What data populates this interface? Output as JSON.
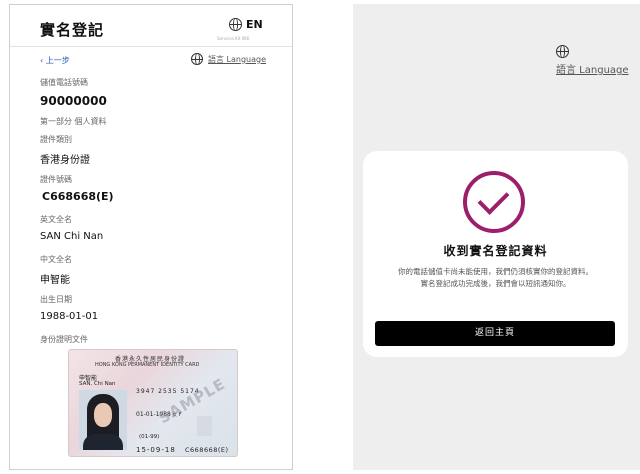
{
  "left": {
    "header": {
      "title": "實名登記",
      "lang_toggle": "EN",
      "sub_text": "Services Kit 0KK"
    },
    "back_label": "上一步",
    "language_link": "語言 Language",
    "fields": {
      "phone_label": "儲值電話號碼",
      "phone_value": "90000000",
      "section_label": "第一部分 個人資料",
      "doc_type_label": "證件類別",
      "doc_type_value": "香港身份證",
      "doc_no_label": "證件號碼",
      "doc_no_value": "C668668(E)",
      "en_name_label": "英文全名",
      "en_name_value": "SAN Chi Nan",
      "cn_name_label": "中文全名",
      "cn_name_value": "申智能",
      "dob_label": "出生日期",
      "dob_value": "1988-01-01",
      "doc_proof_label": "身份證明文件"
    },
    "id_card": {
      "title_cn": "香港永久性居民身份證",
      "title_en": "HONG KONG PERMANENT IDENTITY CARD",
      "name_cn": "申智能",
      "name_en": "SAN, Chi Nan",
      "digits": "3947 2535 5174",
      "dob": "01-01-1988",
      "sex": "女 F",
      "class": "(01-99)",
      "issue": "15-09-18",
      "card_no": "C668668(E)",
      "watermark": "SAMPLE"
    }
  },
  "right": {
    "language_link": "語言 Language",
    "title": "收到實名登記資料",
    "message_line1": "你的電話儲值卡尚未能使用，我們仍須核實你的登記資料。",
    "message_line2": "實名登記成功完成後，我們會以短訊通知你。",
    "button_label": "返回主頁",
    "accent_color": "#9b1f6b"
  }
}
